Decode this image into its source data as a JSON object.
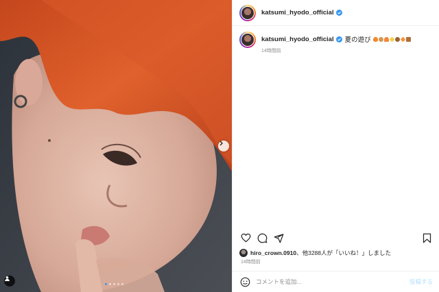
{
  "post": {
    "username": "katsumi_hyodo_official",
    "caption": "夏の遊び",
    "caption_emojis": [
      "fire",
      "cookie",
      "orange-heart",
      "sparkles",
      "brown-circle",
      "orange-diamond",
      "brown-square"
    ],
    "caption_time": "14時間前",
    "carousel": {
      "slides": 5,
      "current": 1
    }
  },
  "actions": {
    "like_icon": "heart-icon",
    "comment_icon": "comment-icon",
    "share_icon": "share-icon",
    "save_icon": "bookmark-icon"
  },
  "likes": {
    "user": "hiro_crown.0910",
    "rest_text": "、他3288人が「いいね！」しました"
  },
  "post_time": "14時間前",
  "comment": {
    "placeholder": "コメントを追加...",
    "post_label": "投稿する"
  },
  "colors": {
    "accent": "#3897f0",
    "post_button_disabled": "#b2dffc",
    "secondary_text": "#8e8e8e"
  }
}
